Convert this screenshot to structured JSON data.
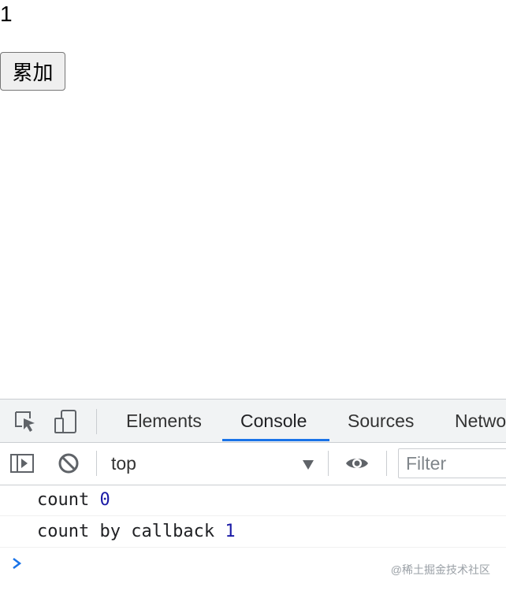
{
  "app": {
    "count_value": "1",
    "add_button_label": "累加"
  },
  "devtools": {
    "tabs": [
      {
        "label": "Elements",
        "active": false
      },
      {
        "label": "Console",
        "active": true
      },
      {
        "label": "Sources",
        "active": false
      },
      {
        "label": "Netwo",
        "active": false
      }
    ],
    "toolbar": {
      "context": "top",
      "filter_placeholder": "Filter"
    },
    "console": {
      "messages": [
        {
          "text": "count",
          "value": "0"
        },
        {
          "text": "count by callback",
          "value": "1"
        }
      ]
    },
    "watermark": "@稀土掘金技术社区",
    "accent_color": "#1a73e8",
    "number_color": "#1a1aa6"
  }
}
